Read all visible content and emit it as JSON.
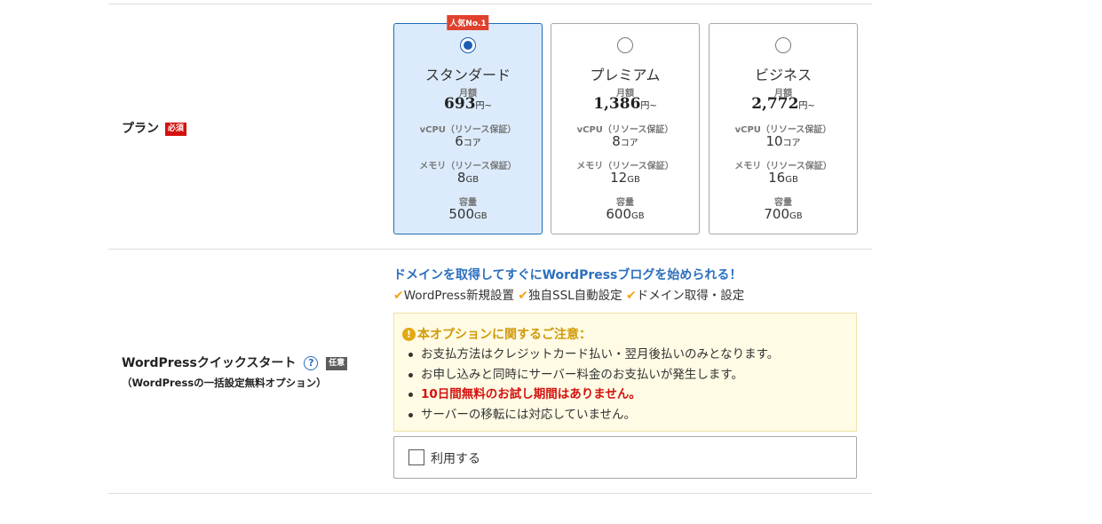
{
  "plan_row": {
    "label": "プラン",
    "required_badge": "必須",
    "popular_badge": "人気No.1",
    "price_label": "月額",
    "vcpu_label": "vCPU（リソース保証）",
    "memory_label": "メモリ（リソース保証）",
    "storage_label": "容量",
    "price_unit": "円~",
    "vcpu_unit": "コア",
    "gb_unit": "GB",
    "plans": [
      {
        "name": "スタンダード",
        "price": "693",
        "vcpu": "6",
        "memory": "8",
        "storage": "500",
        "selected": true
      },
      {
        "name": "プレミアム",
        "price": "1,386",
        "vcpu": "8",
        "memory": "12",
        "storage": "600",
        "selected": false
      },
      {
        "name": "ビジネス",
        "price": "2,772",
        "vcpu": "10",
        "memory": "16",
        "storage": "700",
        "selected": false
      }
    ]
  },
  "wp_row": {
    "label": "WordPressクイックスタート",
    "sublabel": "（WordPressの一括設定無料オプション）",
    "help_icon": "question-circle-icon",
    "optional_badge": "任意",
    "headline": "ドメインを取得してすぐにWordPressブログを始められる！",
    "features": [
      "WordPress新規設置",
      "独自SSL自動設定",
      "ドメイン取得・設定"
    ],
    "notice_title": "本オプションに関するご注意：",
    "notices": [
      {
        "text": "お支払方法はクレジットカード払い・翌月後払いのみとなります。",
        "emphasis": false
      },
      {
        "text": "お申し込みと同時にサーバー料金のお支払いが発生します。",
        "emphasis": false
      },
      {
        "text": "10日間無料のお試し期間はありません。",
        "emphasis": true
      },
      {
        "text": "サーバーの移転には対応していません。",
        "emphasis": false
      }
    ],
    "checkbox_label": "利用する",
    "checkbox_checked": false
  },
  "colors": {
    "required": "#d3120f",
    "optional": "#5c5c5c",
    "popular": "#e0412d",
    "selected_bg": "#dcebfb",
    "selected_border": "#1f6cb5",
    "link_blue": "#2c6fbf",
    "check_orange": "#f3a51a",
    "notice_gold": "#d19a0a"
  }
}
